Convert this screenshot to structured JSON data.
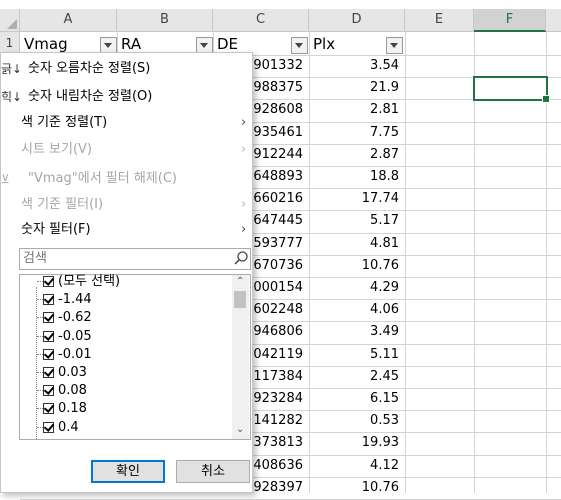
{
  "columns": [
    "A",
    "B",
    "C",
    "D",
    "E",
    "F"
  ],
  "row_numbers": [
    "1"
  ],
  "header_cells": [
    "Vmag",
    "RA",
    "DE",
    "Plx"
  ],
  "column_c_values": [
    "901332",
    "988375",
    "928608",
    "935461",
    "912244",
    "648893",
    "660216",
    "647445",
    "593777",
    "670736",
    "000154",
    "602248",
    "946806",
    "042119",
    "117384",
    "923284",
    "141282",
    "373813",
    "408636",
    "928397"
  ],
  "column_d_values": [
    "3.54",
    "21.9",
    "2.81",
    "7.75",
    "2.87",
    "18.8",
    "17.74",
    "5.17",
    "4.81",
    "10.76",
    "4.29",
    "4.06",
    "3.49",
    "5.11",
    "2.45",
    "6.15",
    "0.53",
    "19.93",
    "4.12",
    "10.76"
  ],
  "menu": {
    "sort_asc": "숫자 오름차순 정렬(S)",
    "sort_desc": "숫자 내림차순 정렬(O)",
    "sort_by_color": "색 기준 정렬(T)",
    "sheet_view": "시트 보기(V)",
    "clear_filter": "\"Vmag\"에서 필터 해제(C)",
    "filter_by_color": "색 기준 필터(I)",
    "number_filters": "숫자 필터(F)",
    "asc_icon_text": "긁",
    "desc_icon_text": "힉"
  },
  "search": {
    "placeholder": "검색"
  },
  "filter_list": [
    "(모두 선택)",
    "-1.44",
    "-0.62",
    "-0.05",
    "-0.01",
    "0.03",
    "0.08",
    "0.18",
    "0.4"
  ],
  "buttons": {
    "ok": "확인",
    "cancel": "취소"
  }
}
